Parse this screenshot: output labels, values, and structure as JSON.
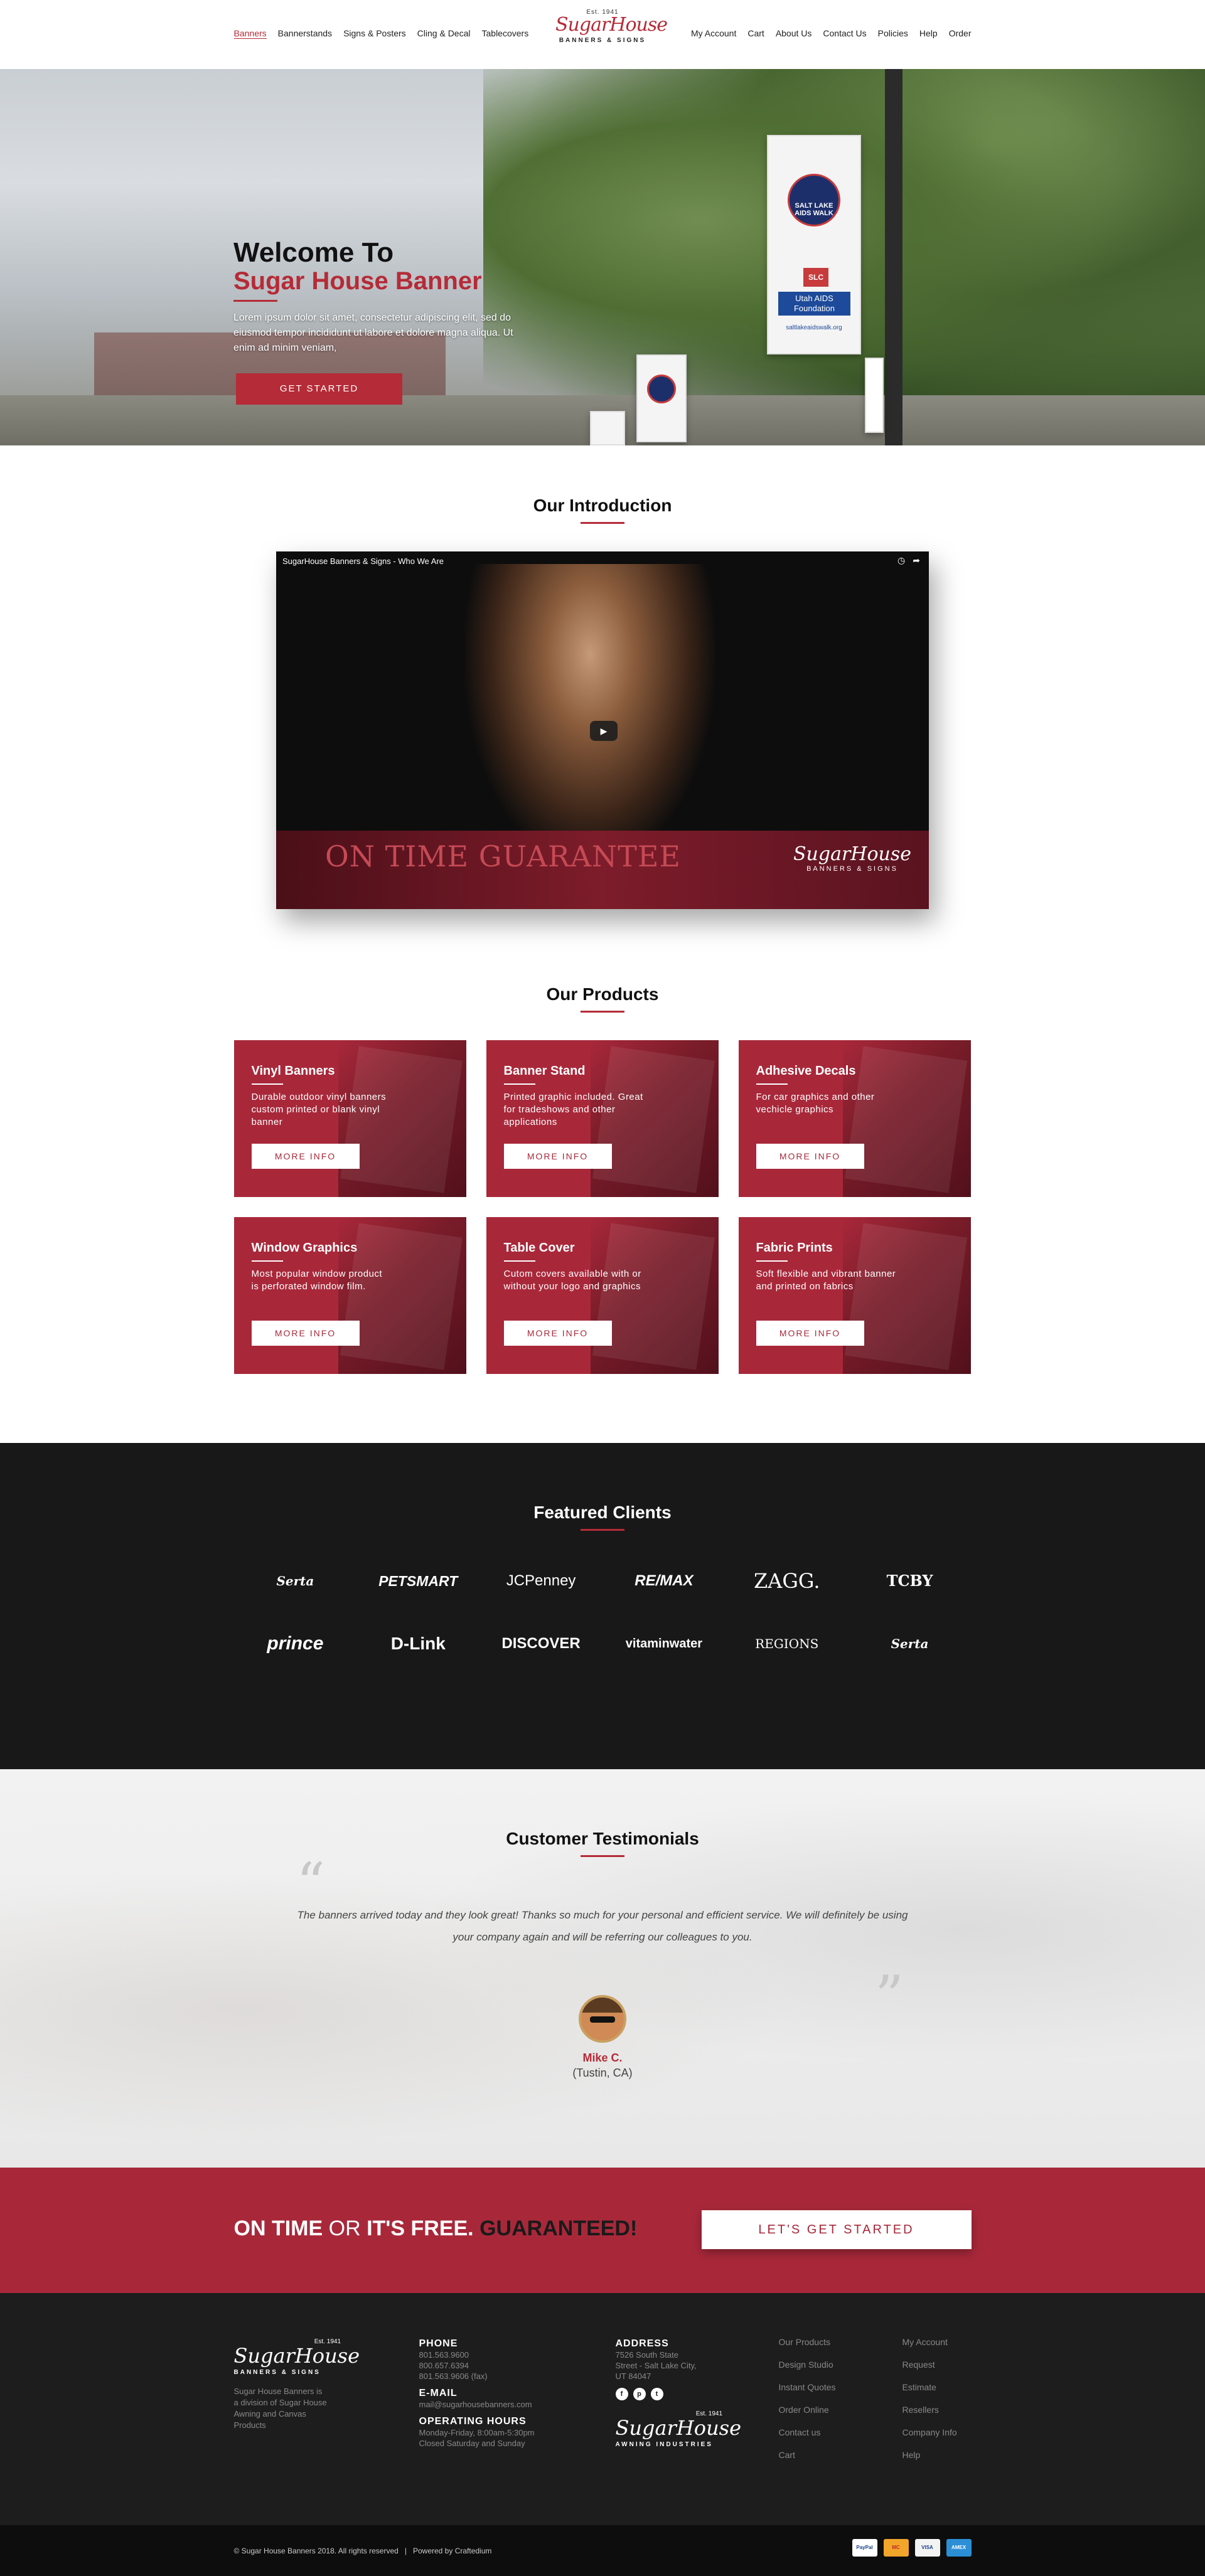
{
  "header": {
    "nav_left": [
      "Banners",
      "Bannerstands",
      "Signs & Posters",
      "Cling & Decal",
      "Tablecovers"
    ],
    "nav_right": [
      "My Account",
      "Cart",
      "About Us",
      "Contact Us",
      "Policies",
      "Help",
      "Order"
    ],
    "logo_est": "Est. 1941",
    "logo_name": "SugarHouse",
    "logo_sub": "BANNERS & SIGNS"
  },
  "hero": {
    "title_line1": "Welcome To",
    "title_line2": "Sugar House Banner",
    "lead": "Lorem ipsum dolor sit amet, consectetur adipiscing elit, sed do eiusmod tempor incididunt ut labore et dolore magna aliqua. Ut enim ad minim veniam,",
    "button": "GET STARTED",
    "banner_text": "SALT LAKE AIDS WALK",
    "banner_badge": "SLC",
    "banner_org": "Utah AIDS Foundation",
    "banner_url": "saltlakeaidswalk.org"
  },
  "intro": {
    "title": "Our Introduction",
    "video_title": "SugarHouse Banners & Signs - Who We Are",
    "banner_text": "ON TIME GUARANTEE",
    "banner_logo": "SugarHouse",
    "banner_logo_sub": "BANNERS & SIGNS"
  },
  "products": {
    "title": "Our Products",
    "items": [
      {
        "title": "Vinyl Banners",
        "desc": "Durable outdoor vinyl banners custom printed or blank vinyl banner",
        "button": "MORE INFO"
      },
      {
        "title": "Banner Stand",
        "desc": "Printed graphic included. Great for tradeshows and other applications",
        "button": "MORE INFO"
      },
      {
        "title": "Adhesive Decals",
        "desc": "For car graphics and other vechicle graphics",
        "button": "MORE INFO"
      },
      {
        "title": "Window Graphics",
        "desc": "Most popular window product is perforated window film.",
        "button": "MORE INFO"
      },
      {
        "title": "Table Cover",
        "desc": "Cutom covers available with or without your logo and graphics",
        "button": "MORE INFO"
      },
      {
        "title": "Fabric Prints",
        "desc": "Soft flexible and vibrant banner and printed on fabrics",
        "button": "MORE INFO"
      }
    ]
  },
  "clients": {
    "title": "Featured Clients",
    "logos": [
      "Serta",
      "PETSMART",
      "JCPenney",
      "RE/MAX",
      "ZAGG.",
      "TCBY",
      "prince",
      "D-Link",
      "DISCOVER",
      "vitaminwater",
      "REGIONS",
      "Serta"
    ]
  },
  "testimonials": {
    "title": "Customer Testimonials",
    "quote": "The banners arrived today and they look great! Thanks so much for your personal and efficient service. We will definitely be using your company again and will be referring our colleagues to you.",
    "name": "Mike C.",
    "location": "(Tustin, CA)"
  },
  "cta": {
    "part1": "ON TIME",
    "part2": "OR",
    "part3": "IT'S FREE.",
    "part4": "GUARANTEED!",
    "button": "LET'S GET STARTED"
  },
  "footer": {
    "logo_est": "Est. 1941",
    "logo_name": "SugarHouse",
    "logo_sub": "BANNERS & SIGNS",
    "desc": "Sugar House Banners is a division of Sugar House Awning and Canvas Products",
    "phone_title": "PHONE",
    "phones": [
      "801.563.9600",
      "800.657.6394",
      "801.563.9606 (fax)"
    ],
    "email_title": "E-MAIL",
    "email": "mail@sugarhousebanners.com",
    "hours_title": "OPERATING HOURS",
    "hours": [
      "Monday-Friday, 8:00am-5:30pm",
      "Closed Saturday and Sunday"
    ],
    "address_title": "ADDRESS",
    "address": [
      "7526 South State",
      "Street - Salt Lake City,",
      "UT 84047"
    ],
    "social": [
      "f",
      "p",
      "t"
    ],
    "awning_est": "Est. 1941",
    "awning_name": "SugarHouse",
    "awning_sub": "AWNING INDUSTRIES",
    "links1": [
      "Our Products",
      "Design Studio",
      "Instant Quotes",
      "Order Online",
      "Contact us",
      "Cart"
    ],
    "links2": [
      "My Account",
      "Request",
      "Estimate",
      "Resellers",
      "Company Info",
      "Help"
    ]
  },
  "bottom": {
    "copyright": "© Sugar House Banners 2018. All rights reserved",
    "separator": "|",
    "powered": "Powered by Craftedium",
    "payments": [
      "PayPal",
      "MC",
      "VISA",
      "AMEX"
    ]
  },
  "colors": {
    "brand": "#b52b37",
    "card": "#a8283a",
    "dark": "#181818"
  }
}
